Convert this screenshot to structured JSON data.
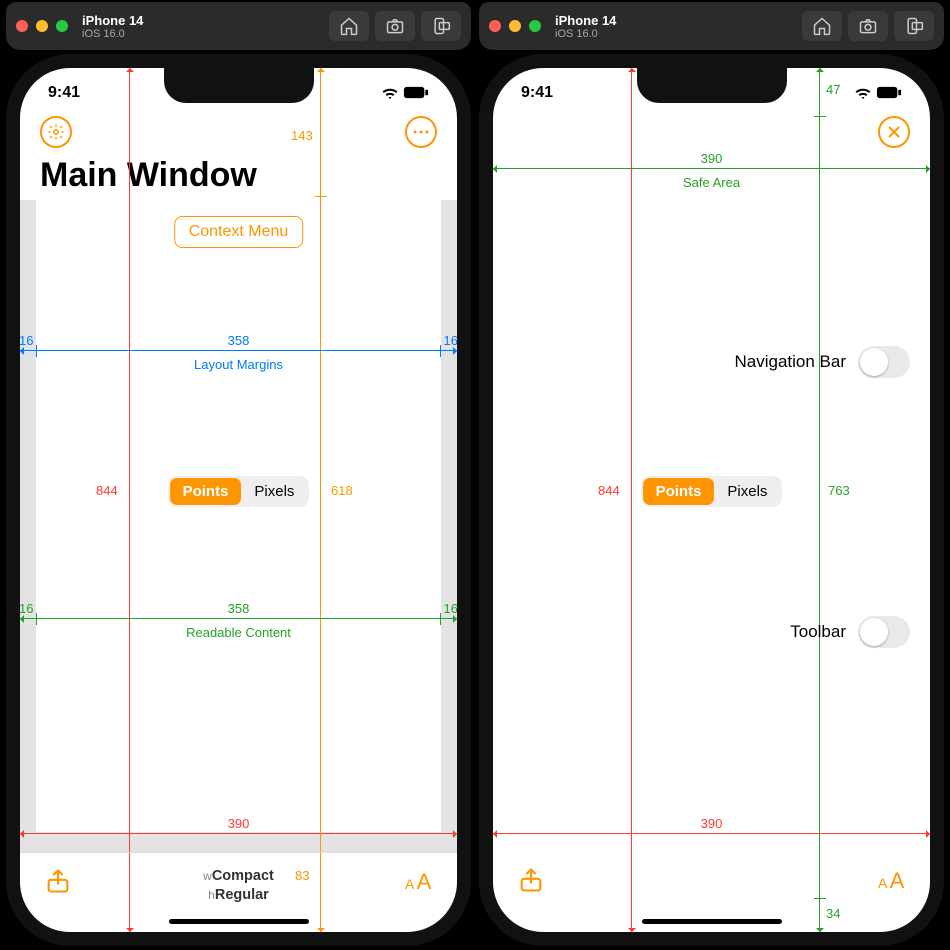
{
  "simulator": {
    "device": "iPhone 14",
    "os": "iOS 16.0"
  },
  "common": {
    "time": "9:41",
    "segmented": {
      "points": "Points",
      "pixels": "Pixels"
    },
    "full_height_pt": "844",
    "full_width_pt": "390"
  },
  "left": {
    "title": "Main Window",
    "context_menu_label": "Context Menu",
    "layout_margins": {
      "label": "Layout Margins",
      "width": "358",
      "left": "16",
      "right": "16"
    },
    "readable": {
      "label": "Readable Content",
      "width": "358",
      "left": "16",
      "right": "16"
    },
    "content_top_offset": "143",
    "content_height": "618",
    "content_bottom_offset": "83",
    "size_class_w_prefix": "w",
    "size_class_w": "Compact",
    "size_class_h_prefix": "h",
    "size_class_h": "Regular"
  },
  "right": {
    "safe_area_label": "Safe Area",
    "safe_area_width": "390",
    "safe_top_inset": "47",
    "safe_height": "763",
    "safe_bottom_inset": "34",
    "nav_bar_label": "Navigation Bar",
    "toolbar_label": "Toolbar"
  }
}
